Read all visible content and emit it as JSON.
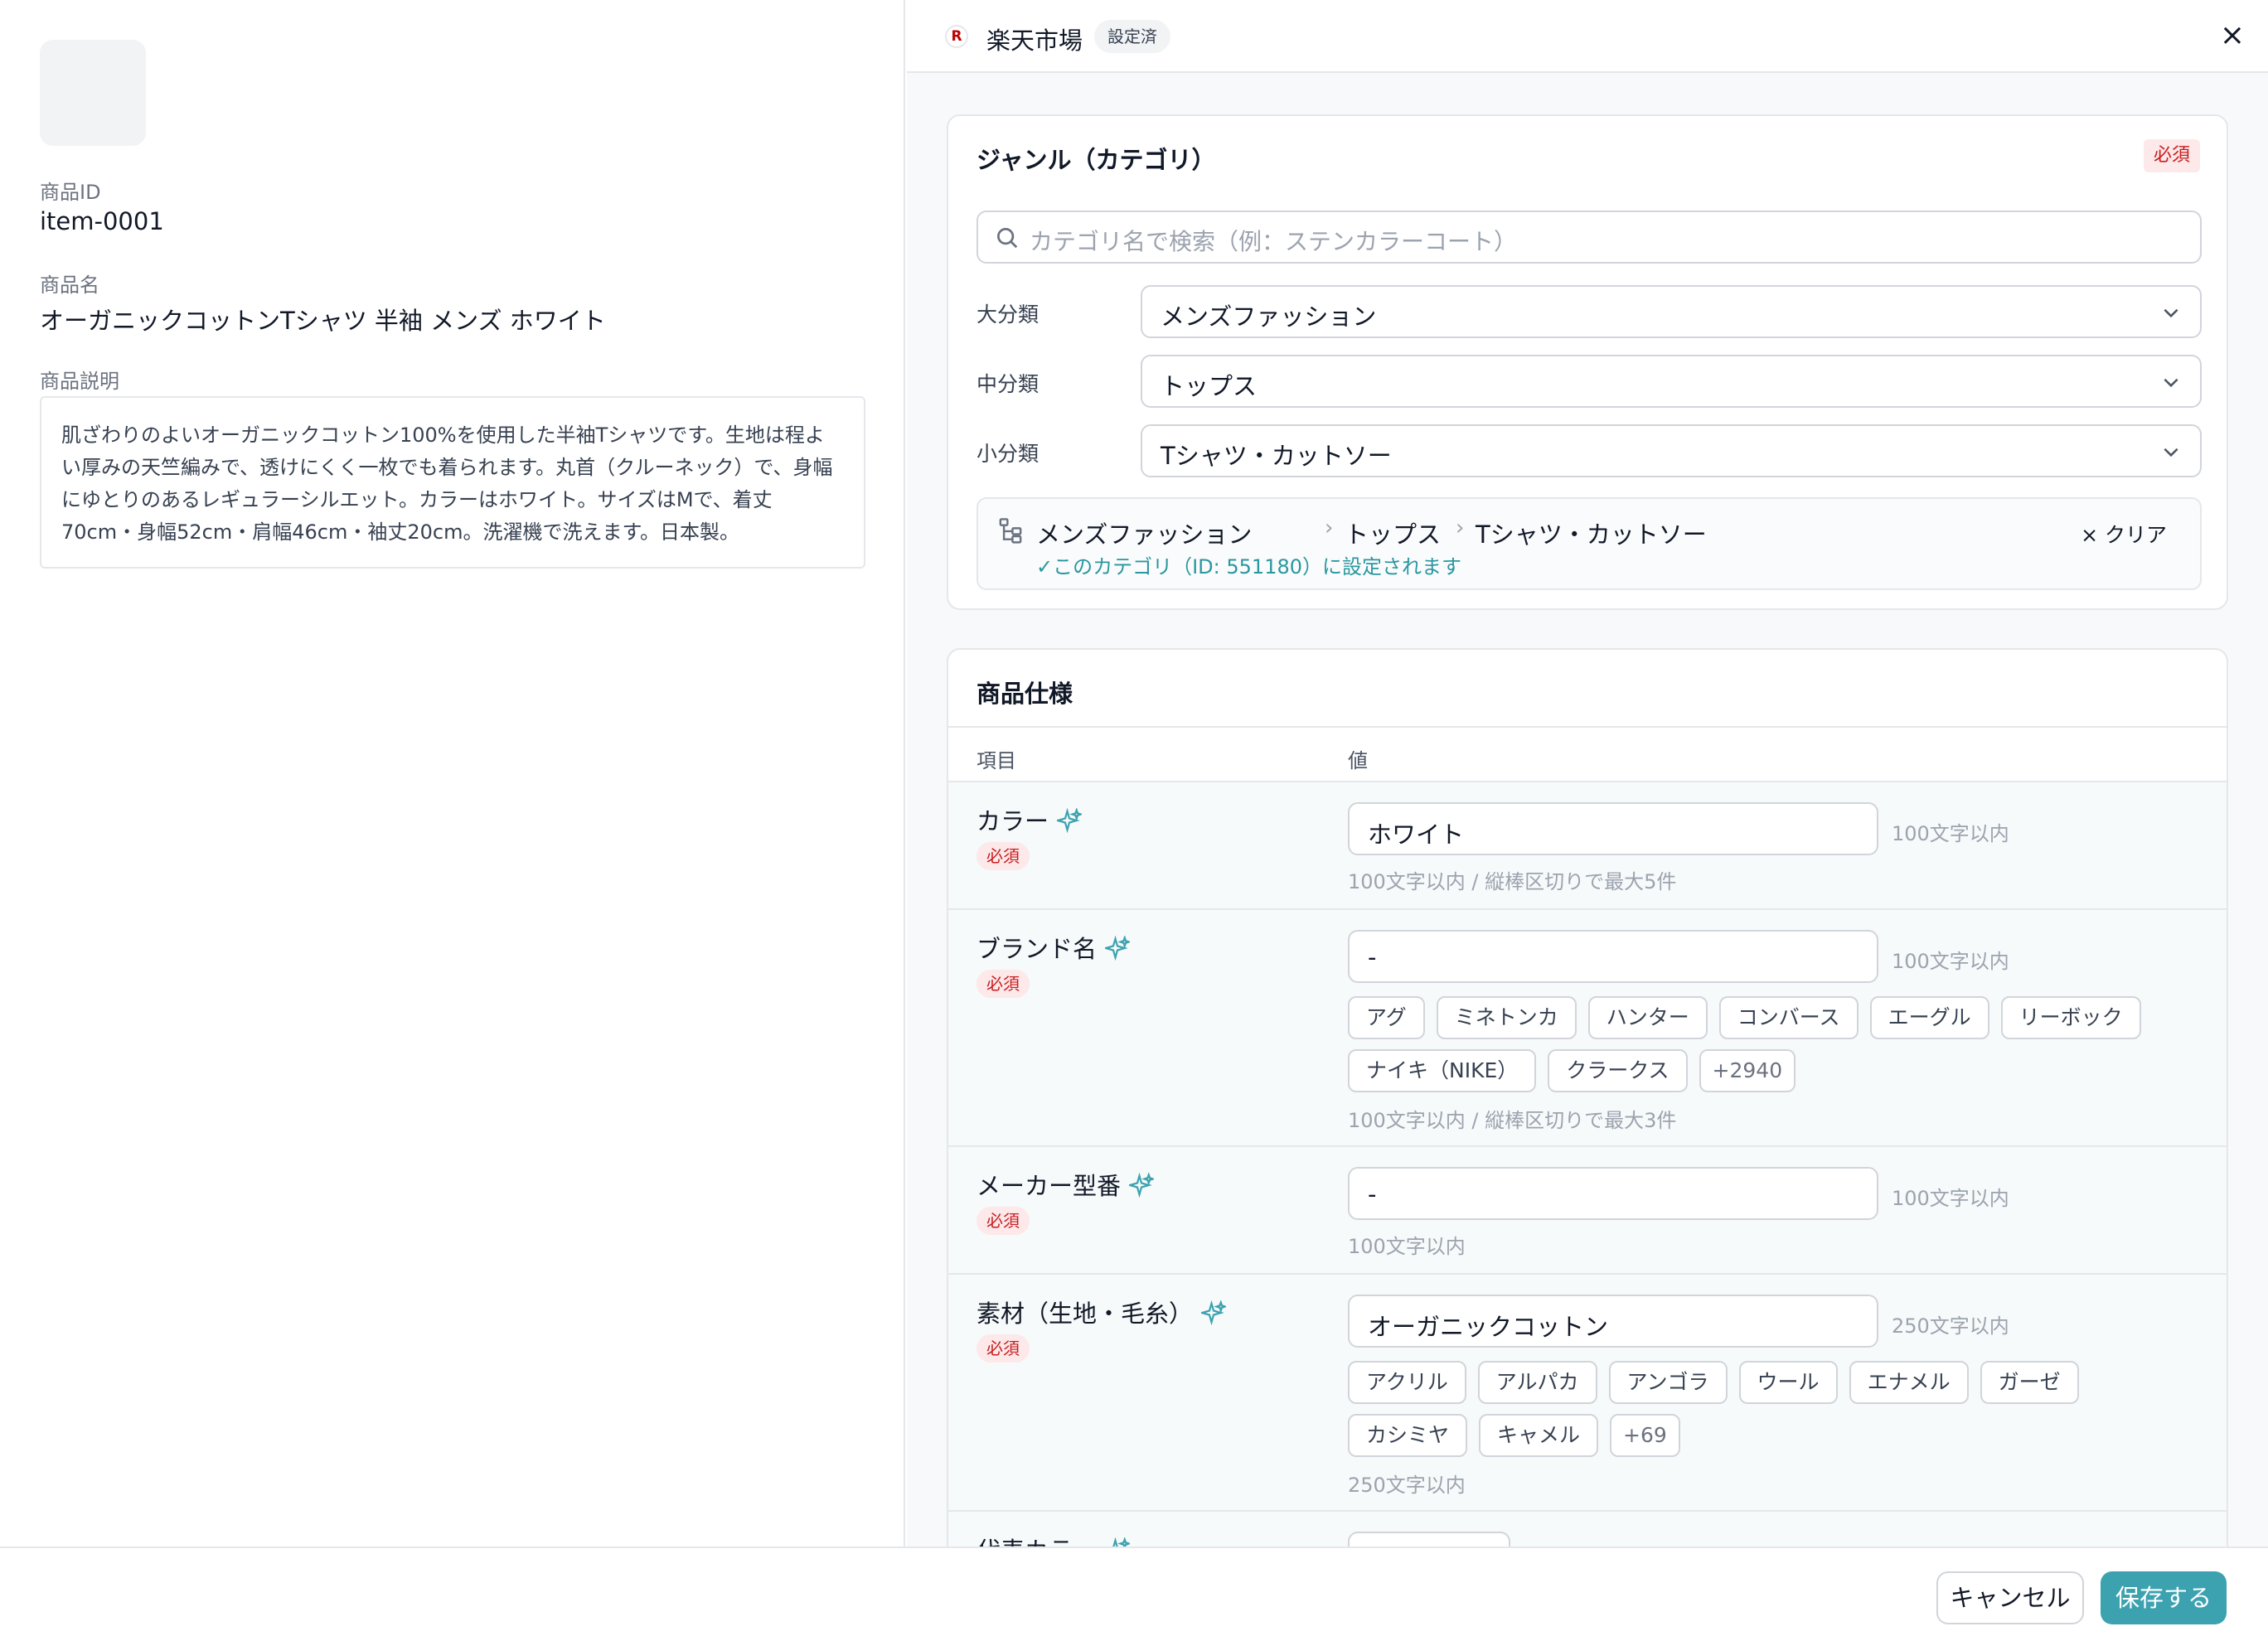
{
  "item": {
    "id_label": "商品ID",
    "id_value": "item-0001",
    "name_label": "商品名",
    "name_value": "オーガニックコットンTシャツ 半袖 メンズ ホワイト",
    "desc_label": "商品説明",
    "desc_value": "肌ざわりのよいオーガニックコットン100%を使用した半袖Tシャツです。生地は程よい厚みの天竺編みで、透けにくく一枚でも着られます。丸首（クルーネック）で、身幅にゆとりのあるレギュラーシルエット。カラーはホワイト。サイズはMで、着丈70cm・身幅52cm・肩幅46cm・袖丈20cm。洗濯機で洗えます。日本製。"
  },
  "header": {
    "logo_letter": "R",
    "shop_name": "楽天市場",
    "status_badge": "設定済",
    "close_icon": "×"
  },
  "genre": {
    "title": "ジャンル（カテゴリ）",
    "required": "必須",
    "search_placeholder": "カテゴリ名で検索（例：ステンカラーコート）",
    "large_label": "大分類",
    "large_value": "メンズファッション",
    "medium_label": "中分類",
    "medium_value": "トップス",
    "small_label": "小分類",
    "small_value": "Tシャツ・カットソー",
    "breadcrumb": [
      "メンズファッション",
      "トップス",
      "Tシャツ・カットソー"
    ],
    "breadcrumb_sep": "›",
    "note": "✓このカテゴリ（ID: 551180）に設定されます",
    "clear_label": "× クリア"
  },
  "specs": {
    "title": "商品仕様",
    "col_item": "項目",
    "col_value": "値",
    "rows": [
      {
        "name": "カラー",
        "required": "必須",
        "value": "ホワイト",
        "limit": "100文字以内",
        "hint": "100文字以内 / 縦棒区切りで最大5件",
        "chips": []
      },
      {
        "name": "ブランド名",
        "required": "必須",
        "value": "-",
        "limit": "100文字以内",
        "hint": "100文字以内 / 縦棒区切りで最大3件",
        "chips": [
          "アグ",
          "ミネトンカ",
          "ハンター",
          "コンバース",
          "エーグル",
          "リーボック",
          "ナイキ（NIKE）",
          "クラークス"
        ],
        "more": "+2940"
      },
      {
        "name": "メーカー型番",
        "required": "必須",
        "value": "-",
        "limit": "100文字以内",
        "hint": "100文字以内",
        "chips": []
      },
      {
        "name": "素材（生地・毛糸）",
        "required": "必須",
        "value": "オーガニックコットン",
        "limit": "250文字以内",
        "hint": "250文字以内",
        "chips": [
          "アクリル",
          "アルパカ",
          "アンゴラ",
          "ウール",
          "エナメル",
          "ガーゼ",
          "カシミヤ",
          "キャメル"
        ],
        "more": "+69"
      },
      {
        "name": "代表カラー"
      }
    ]
  },
  "footer": {
    "cancel": "キャンセル",
    "save": "保存する"
  },
  "colors": {
    "accent": "#3ca2b0",
    "required_bg": "#fde8ea",
    "required_text": "#c81e1e",
    "brand_red": "#bf0000"
  }
}
